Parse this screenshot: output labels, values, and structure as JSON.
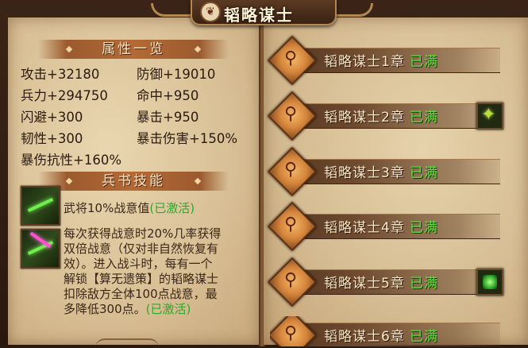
{
  "title": "韬略谋士",
  "title_icon_glyph": "❦",
  "attributes": {
    "header": "属性一览",
    "stats": [
      {
        "label": "攻击+32180"
      },
      {
        "label": "防御+19010"
      },
      {
        "label": "兵力+294750"
      },
      {
        "label": "命中+950"
      },
      {
        "label": "闪避+300"
      },
      {
        "label": "暴击+950"
      },
      {
        "label": "韧性+300"
      },
      {
        "label": "暴击伤害+150%"
      },
      {
        "label": "暴伤抗性+160%"
      }
    ]
  },
  "skills": {
    "header": "兵书技能",
    "items": [
      {
        "lines": [
          "武将10%战意值"
        ],
        "status": "(已激活)"
      },
      {
        "lines": [
          "每次获得战意时20%几率获得",
          "双倍战意（仅对非自然恢复有",
          "效）。进入战斗时，每有一个",
          "解锁【算无遗策】的韬略谋士",
          "扣除敌方全体100点战意，最",
          "多降低300点。"
        ],
        "status": "(已激活)"
      }
    ]
  },
  "chapters": [
    {
      "name": "韬略谋士1章",
      "status": "已满",
      "reward": ""
    },
    {
      "name": "韬略谋士2章",
      "status": "已满",
      "reward": "leaf"
    },
    {
      "name": "韬略谋士3章",
      "status": "已满",
      "reward": ""
    },
    {
      "name": "韬略谋士4章",
      "status": "已满",
      "reward": ""
    },
    {
      "name": "韬略谋士5章",
      "status": "已满",
      "reward": "gem"
    },
    {
      "name": "韬略谋士6章",
      "status": "已满",
      "reward": ""
    }
  ],
  "chapter_badge_glyph": "⚲",
  "colors": {
    "status_green": "#5fe23a",
    "skill_active_green": "#2fa82a",
    "parchment": "#e6d2ac"
  }
}
